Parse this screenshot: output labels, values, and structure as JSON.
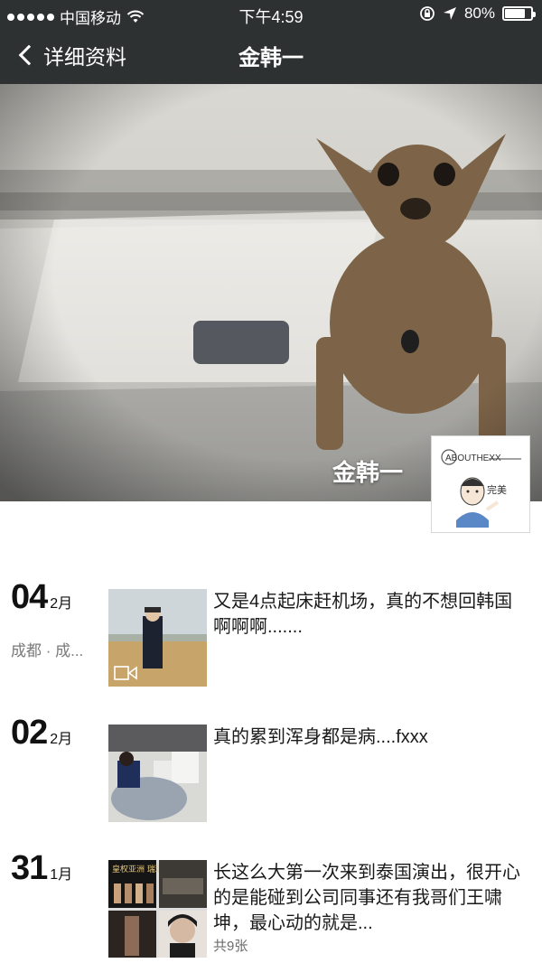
{
  "status_bar": {
    "carrier": "中国移动",
    "time": "下午4:59",
    "battery_percent": "80%",
    "battery_level": 0.8
  },
  "nav": {
    "back_label": "详细资料",
    "title": "金韩一"
  },
  "profile": {
    "cover_name": "金韩一",
    "avatar_brand": "ABOUTHEXX",
    "avatar_caption": "完美"
  },
  "posts": [
    {
      "day": "04",
      "month": "2月",
      "location": "成都 · 成...",
      "text": "又是4点起床赶机场，真的不想回韩国啊啊啊.......",
      "media": "video"
    },
    {
      "day": "02",
      "month": "2月",
      "text": "真的累到浑身都是病....fxxx",
      "media": "photo"
    },
    {
      "day": "31",
      "month": "1月",
      "text": "长这么大第一次来到泰国演出，很开心的是能碰到公司同事还有我哥们王啸坤，最心动的就是...",
      "photo_count": "共9张",
      "collage_caption": "皇权亚洲 瑞璐曼谷",
      "media": "collage"
    }
  ],
  "icons": {
    "signal": "signal-dots-icon",
    "wifi": "wifi-icon",
    "lock": "orientation-lock-icon",
    "location": "location-arrow-icon",
    "battery": "battery-icon",
    "back": "chevron-left-icon",
    "video": "video-camera-icon"
  },
  "colors": {
    "nav_background": "#2e3132",
    "text_primary": "#1a1a1a",
    "text_secondary": "#7a7a7a"
  }
}
